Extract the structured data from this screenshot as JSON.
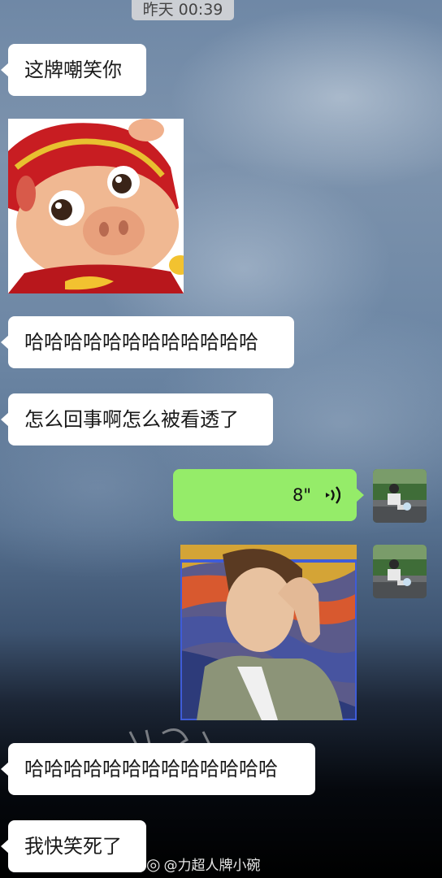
{
  "timestamp": "昨天 00:39",
  "messages": [
    {
      "side": "left",
      "type": "text",
      "text": "这牌嘲笑你"
    },
    {
      "side": "left",
      "type": "sticker",
      "icon": "pig-cartoon-sticker"
    },
    {
      "side": "left",
      "type": "text",
      "text": "哈哈哈哈哈哈哈哈哈哈哈哈"
    },
    {
      "side": "left",
      "type": "text",
      "text": "怎么回事啊怎么被看透了"
    },
    {
      "side": "right",
      "type": "voice",
      "duration": "8\""
    },
    {
      "side": "right",
      "type": "sticker",
      "icon": "man-hand-on-head-sticker"
    },
    {
      "side": "left",
      "type": "text",
      "text": "哈哈哈哈哈哈哈哈哈哈哈哈哈"
    },
    {
      "side": "left",
      "type": "text",
      "text": "我快笑死了"
    }
  ],
  "watermark": {
    "logo": "weibo-logo",
    "handle": "@力超人牌小碗"
  },
  "colors": {
    "sent_bubble": "#95ec69",
    "received_bubble": "#ffffff"
  }
}
